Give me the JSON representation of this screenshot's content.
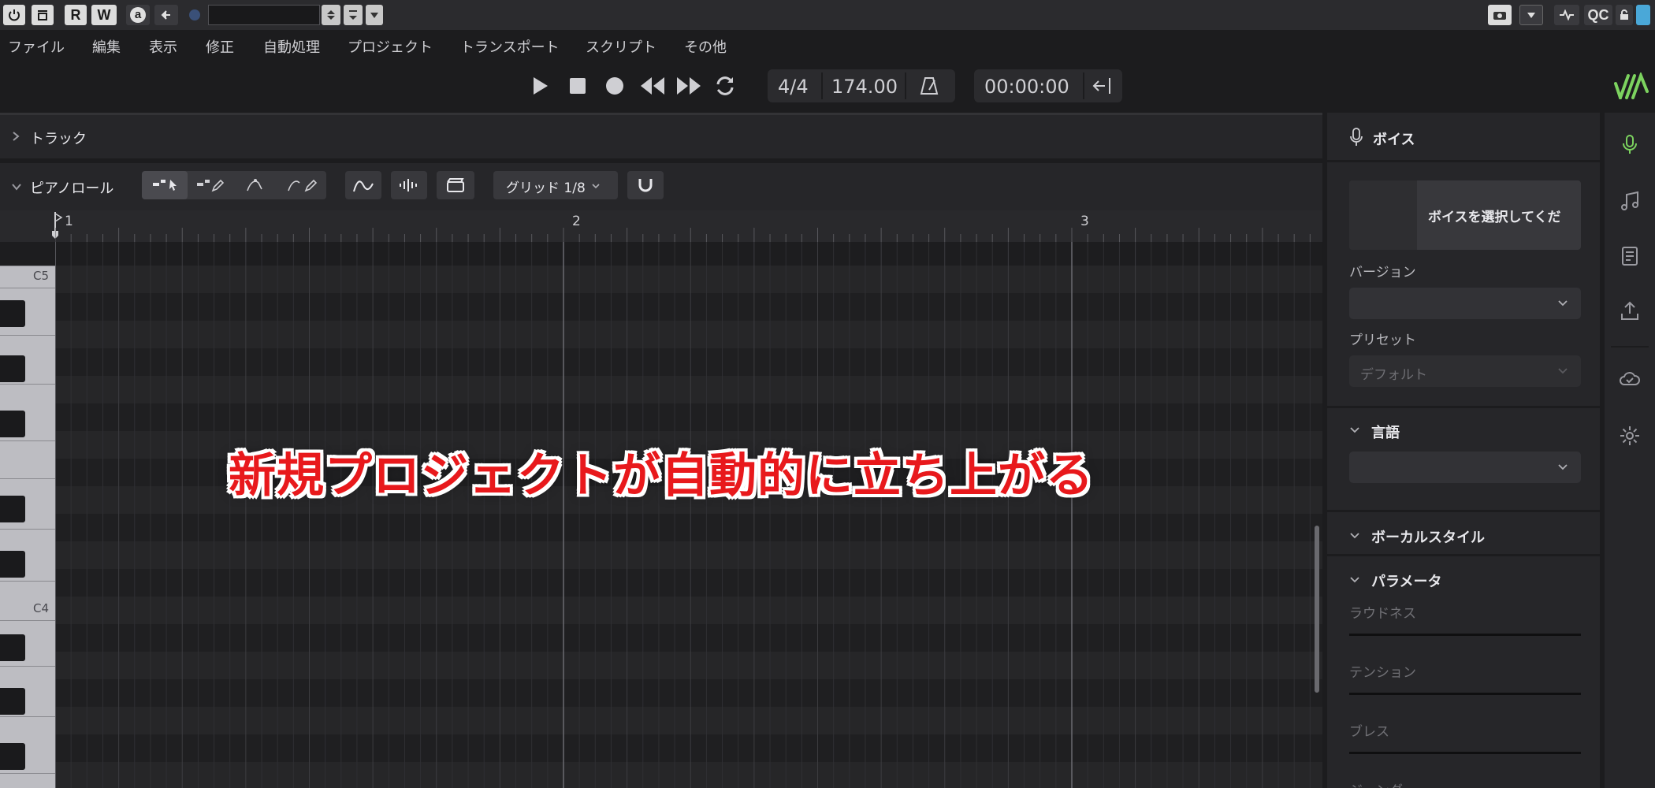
{
  "host_toolbar": {
    "buttons": [
      "R",
      "W",
      "a"
    ],
    "right_label": "QC"
  },
  "menu": {
    "items": [
      "ファイル",
      "編集",
      "表示",
      "修正",
      "自動処理",
      "プロジェクト",
      "トランスポート",
      "スクリプト",
      "その他"
    ]
  },
  "transport": {
    "time_signature": "4/4",
    "tempo": "174.00",
    "time": "00:00:00"
  },
  "tracks_panel": {
    "title": "トラック"
  },
  "piano_roll": {
    "title": "ピアノロール",
    "grid_label": "グリッド 1/8",
    "ruler": [
      "1",
      "2",
      "3"
    ],
    "key_labels": {
      "c5": "C5",
      "c4": "C4"
    }
  },
  "voice_panel": {
    "title": "ボイス",
    "select_voice": "ボイスを選択してくだ",
    "version_label": "バージョン",
    "preset_label": "プリセット",
    "preset_value": "デフォルト",
    "language_section": "言語",
    "vocal_style_section": "ボーカルスタイル",
    "params_section": "パラメータ",
    "params": [
      "ラウドネス",
      "テンション",
      "ブレス",
      "ジェンダー"
    ]
  },
  "overlay_caption": "新規プロジェクトが自動的に立ち上がる",
  "colors": {
    "accent_green": "#7cd35f",
    "caption_red": "#e8191c",
    "background": "#1c1c1e",
    "panel": "#262629"
  }
}
